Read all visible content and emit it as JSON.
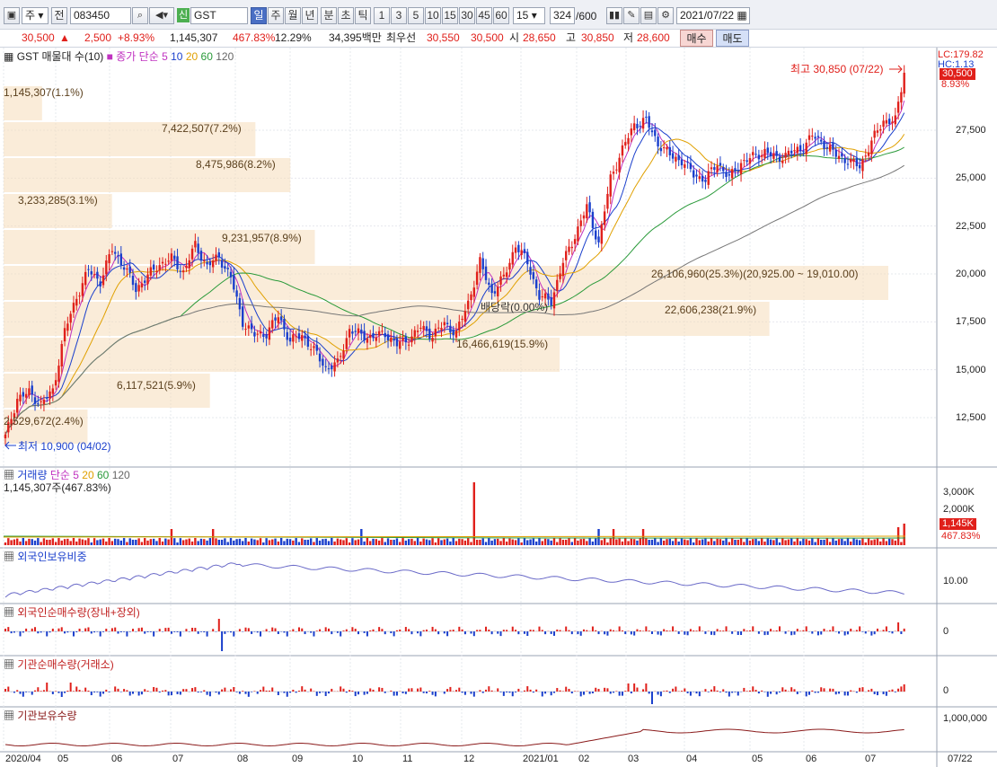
{
  "toolbar": {
    "market_label": "주",
    "prev_label": "전",
    "stock_code": "083450",
    "sin_label": "신",
    "stock_name": "GST",
    "periods": [
      "일",
      "주",
      "월",
      "년",
      "분",
      "초",
      "틱"
    ],
    "selected_period": "일",
    "intervals": [
      "1",
      "3",
      "5",
      "10",
      "15",
      "30",
      "45",
      "60"
    ],
    "interval_value": "15",
    "count": "324",
    "count_total": "/600",
    "date": "2021/07/22"
  },
  "price_bar": {
    "price": "30,500",
    "change": "2,500",
    "change_pct": "+8.93%",
    "volume": "1,145,307",
    "volume_ratio": "467.83%",
    "turnover": "12.29%",
    "amount": "34,395백만",
    "best_ask_label": "최우선",
    "best_ask": "30,550",
    "best_bid": "30,500",
    "open_label": "시",
    "open": "28,650",
    "high_label": "고",
    "high": "30,850",
    "low_label": "저",
    "low": "28,600",
    "buy_label": "매수",
    "sell_label": "매도"
  },
  "price_pane": {
    "legend_name": "GST 매물대 수(10)",
    "legend_ma_label": "종가 단순",
    "ma_periods": [
      "5",
      "10",
      "20",
      "60",
      "120"
    ],
    "ma_colors": [
      "#c032c0",
      "#1a3fcc",
      "#e0a000",
      "#2a9a3a",
      "#666666"
    ],
    "lc_label": "LC:179.82",
    "hc_label": "HC:1.13",
    "last_price_tag": "30,500",
    "last_pct_tag": "8.93%",
    "high_annot": "최고 30,850 (07/22)",
    "low_annot": "최저 10,900 (04/02)",
    "dividend_annot": "배당락(0.00%)",
    "y_ticks": [
      "27,500",
      "25,000",
      "22,500",
      "20,000",
      "17,500",
      "15,000",
      "12,500"
    ],
    "volume_profile": [
      {
        "label": "1,145,307(1.1%)",
        "fraction": 0.011
      },
      {
        "label": "7,422,507(7.2%)",
        "fraction": 0.072
      },
      {
        "label": "8,475,986(8.2%)",
        "fraction": 0.082
      },
      {
        "label": "3,233,285(3.1%)",
        "fraction": 0.031
      },
      {
        "label": "9,231,957(8.9%)",
        "fraction": 0.089
      },
      {
        "label": "26,106,960(25.3%)(20,925.00 ~ 19,010.00)",
        "fraction": 0.253
      },
      {
        "label": "22,606,238(21.9%)",
        "fraction": 0.219
      },
      {
        "label": "16,466,619(15.9%)",
        "fraction": 0.159
      },
      {
        "label": "6,117,521(5.9%)",
        "fraction": 0.059
      },
      {
        "label": "2,529,672(2.4%)",
        "fraction": 0.024
      }
    ]
  },
  "volume_pane": {
    "title": "거래량",
    "ma_label": "단순",
    "ma_periods": [
      "5",
      "20",
      "60",
      "120"
    ],
    "value_text": "1,145,307주(467.83%)",
    "y_ticks": [
      "3,000K",
      "2,000K"
    ],
    "last_tag": "1,145K",
    "last_pct": "467.83%"
  },
  "foreign_ratio_pane": {
    "title": "외국인보유비중",
    "y_tick": "10.00"
  },
  "foreign_net_pane": {
    "title": "외국인순매수량(장내+장외)",
    "y_tick": "0"
  },
  "inst_net_pane": {
    "title": "기관순매수량(거래소)",
    "y_tick": "0"
  },
  "inst_hold_pane": {
    "title": "기관보유수량",
    "y_tick": "1,000,000"
  },
  "x_axis": {
    "labels": [
      "2020/04",
      "05",
      "06",
      "07",
      "08",
      "09",
      "10",
      "11",
      "12",
      "2021/01",
      "02",
      "03",
      "04",
      "05",
      "06",
      "07"
    ],
    "end_label": "07/22"
  },
  "chart_data": {
    "type": "candlestick",
    "y_range": [
      10900,
      30850
    ],
    "close_path": [
      [
        0,
        11500
      ],
      [
        4,
        13500
      ],
      [
        8,
        13800
      ],
      [
        12,
        13200
      ],
      [
        16,
        13900
      ],
      [
        20,
        17000
      ],
      [
        24,
        18800
      ],
      [
        28,
        20200
      ],
      [
        32,
        19600
      ],
      [
        36,
        21300
      ],
      [
        40,
        20400
      ],
      [
        44,
        19200
      ],
      [
        48,
        19900
      ],
      [
        52,
        20500
      ],
      [
        56,
        20800
      ],
      [
        60,
        20100
      ],
      [
        64,
        21500
      ],
      [
        68,
        20400
      ],
      [
        72,
        20900
      ],
      [
        76,
        19800
      ],
      [
        80,
        17500
      ],
      [
        84,
        16800
      ],
      [
        88,
        16900
      ],
      [
        92,
        17800
      ],
      [
        96,
        16500
      ],
      [
        100,
        16800
      ],
      [
        104,
        16000
      ],
      [
        108,
        15100
      ],
      [
        112,
        15300
      ],
      [
        116,
        17100
      ],
      [
        120,
        16800
      ],
      [
        124,
        16700
      ],
      [
        128,
        16900
      ],
      [
        132,
        16300
      ],
      [
        136,
        16600
      ],
      [
        140,
        17200
      ],
      [
        144,
        16800
      ],
      [
        148,
        17400
      ],
      [
        152,
        16900
      ],
      [
        156,
        18500
      ],
      [
        160,
        20600
      ],
      [
        164,
        19000
      ],
      [
        168,
        19800
      ],
      [
        172,
        21500
      ],
      [
        176,
        20600
      ],
      [
        180,
        18800
      ],
      [
        184,
        18600
      ],
      [
        188,
        20600
      ],
      [
        192,
        22000
      ],
      [
        196,
        23500
      ],
      [
        200,
        21600
      ],
      [
        204,
        25000
      ],
      [
        208,
        26500
      ],
      [
        212,
        27800
      ],
      [
        216,
        28000
      ],
      [
        220,
        26800
      ],
      [
        224,
        26200
      ],
      [
        228,
        25900
      ],
      [
        232,
        25200
      ],
      [
        236,
        24900
      ],
      [
        240,
        25800
      ],
      [
        244,
        25000
      ],
      [
        248,
        25800
      ],
      [
        252,
        26100
      ],
      [
        256,
        26400
      ],
      [
        260,
        26000
      ],
      [
        264,
        26300
      ],
      [
        268,
        26500
      ],
      [
        272,
        27200
      ],
      [
        276,
        26800
      ],
      [
        280,
        26200
      ],
      [
        284,
        25900
      ],
      [
        288,
        25600
      ],
      [
        292,
        26900
      ],
      [
        296,
        28000
      ],
      [
        300,
        28000
      ],
      [
        303,
        30500
      ]
    ],
    "total_points": 304
  }
}
